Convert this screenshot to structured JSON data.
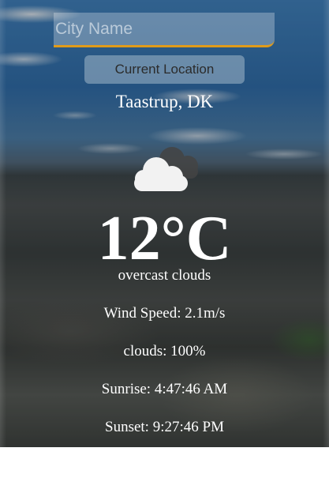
{
  "search": {
    "placeholder": "City Name",
    "value": ""
  },
  "location_button": {
    "label": "Current Location"
  },
  "city": "Taastrup, DK",
  "weather": {
    "icon": "overcast-clouds-icon",
    "temperature": "12°C",
    "description": "overcast clouds",
    "wind_speed": "Wind Speed: 2.1m/s",
    "clouds": "clouds: 100%",
    "sunrise": "Sunrise: 4:47:46 AM",
    "sunset": "Sunset: 9:27:46 PM"
  },
  "colors": {
    "accent_underline": "#e09b1a",
    "text": "#ffffff"
  }
}
